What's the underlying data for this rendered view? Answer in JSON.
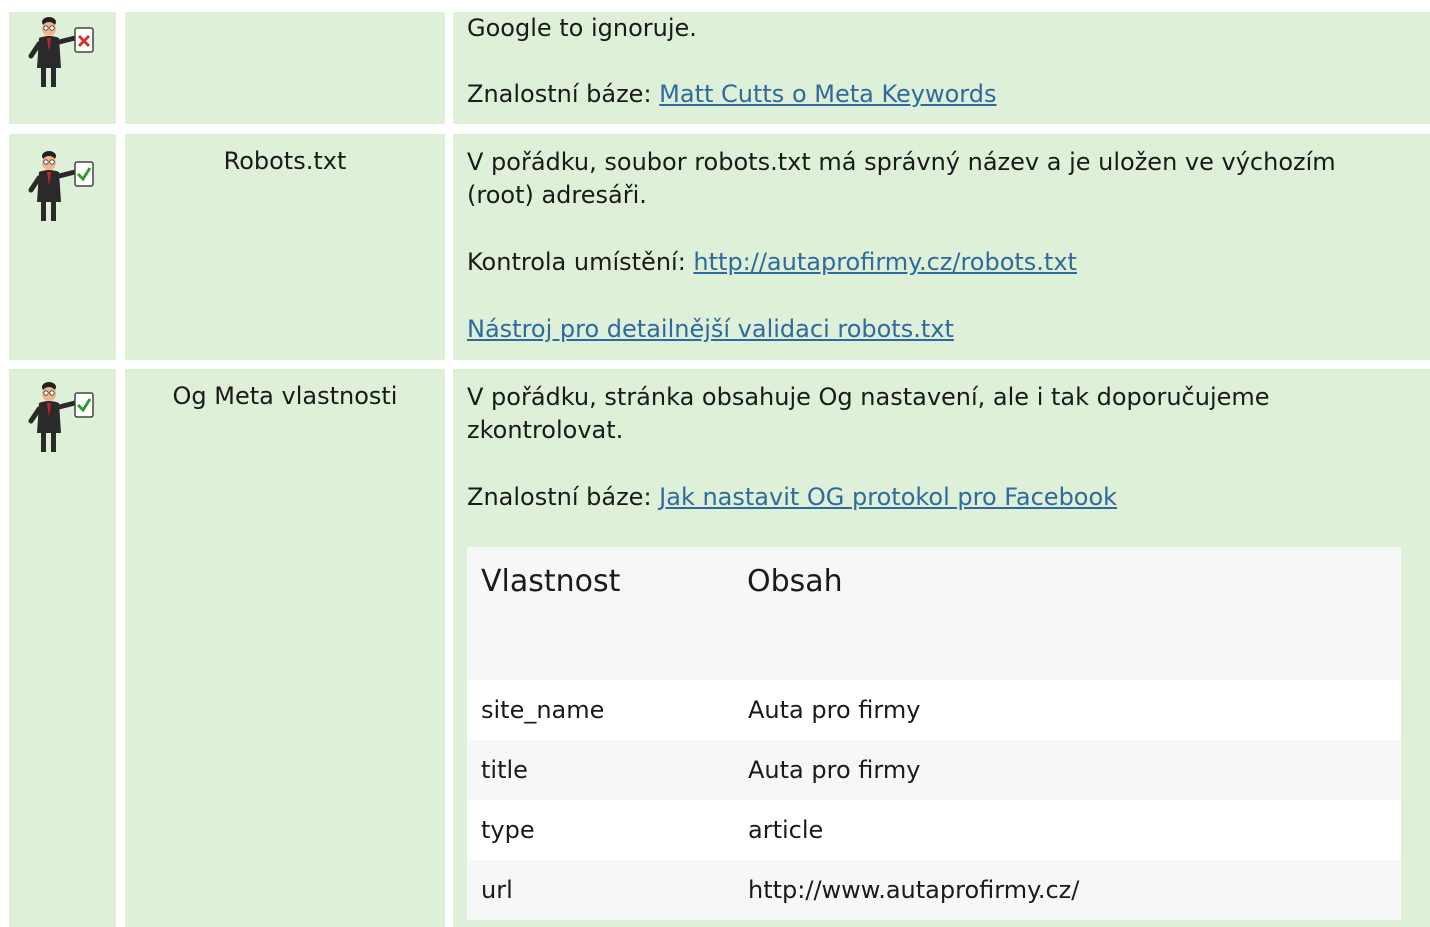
{
  "rows": [
    {
      "status": "fail",
      "name": "",
      "lines": [
        "Google to ignoruje."
      ],
      "kb_prefix": "Znalostní báze: ",
      "kb_link": "Matt Cutts o Meta Keywords"
    },
    {
      "status": "ok",
      "name": "Robots.txt",
      "text": "V pořádku, soubor robots.txt má správný název a je uložen ve výchozím (root) adresáři.",
      "check_prefix": "Kontrola umístění: ",
      "check_link": "http://autaprofirmy.cz/robots.txt",
      "tool_link": "Nástroj pro detailnější validaci robots.txt"
    },
    {
      "status": "ok",
      "name": "Og Meta vlastnosti",
      "text": "V pořádku, stránka obsahuje Og nastavení, ale i tak doporučujeme zkontrolovat.",
      "kb_prefix": "Znalostní báze: ",
      "kb_link": "Jak nastavit OG protokol pro Facebook",
      "table": {
        "headers": [
          "Vlastnost",
          "Obsah"
        ],
        "rows": [
          [
            "site_name",
            "Auta pro firmy"
          ],
          [
            "title",
            "Auta pro firmy"
          ],
          [
            "type",
            "article"
          ],
          [
            "url",
            "http://www.autaprofirmy.cz/"
          ]
        ]
      }
    }
  ],
  "icons": {
    "fail": "businessman-fail-icon",
    "ok": "businessman-ok-icon"
  },
  "colors": {
    "row_bg": "#dff0d8",
    "link": "#2e6a9e",
    "check": "#2e9e2e",
    "cross": "#d9322a"
  }
}
